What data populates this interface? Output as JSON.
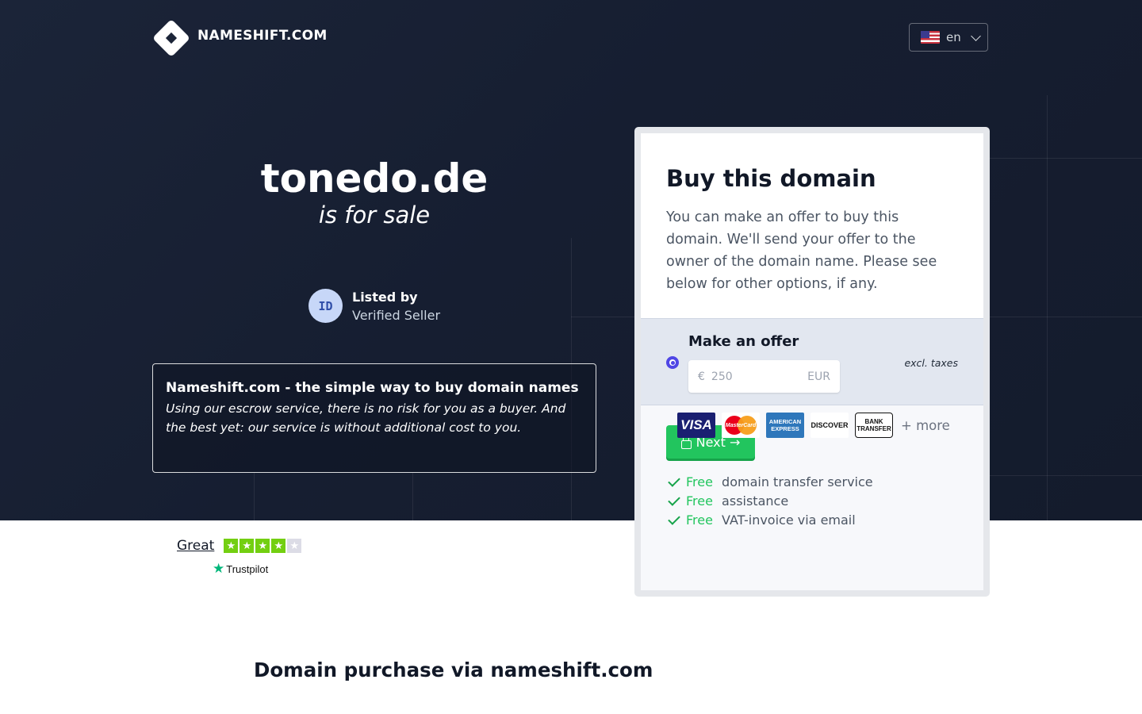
{
  "header": {
    "brand": "NAMESHIFT.COM",
    "language": "en"
  },
  "hero": {
    "domain": "tonedo.de",
    "tagline": "is for sale",
    "seller": {
      "initials": "ID",
      "label": "Listed by",
      "status": "Verified Seller"
    },
    "info": {
      "title": "Nameshift.com - the simple way to buy domain names",
      "text": "Using our escrow service, there is no risk for you as a buyer. And the best yet: our service is without additional cost to you."
    }
  },
  "card": {
    "title": "Buy this domain",
    "description": "You can make an offer to buy this domain. We'll send your offer to the owner of the domain name. Please see below for other options, if any.",
    "offer": {
      "label": "Make an offer",
      "currency_symbol": "€",
      "placeholder": "250",
      "currency_code": "EUR",
      "tax_note": "excl. taxes",
      "selected": true
    },
    "next_label": "Next →",
    "perks": [
      {
        "free": "Free",
        "text": "domain transfer service"
      },
      {
        "free": "Free",
        "text": "assistance"
      },
      {
        "free": "Free",
        "text": "VAT-invoice via email"
      }
    ],
    "payment_methods": [
      "VISA",
      "MasterCard",
      "AMERICAN EXPRESS",
      "DISCOVER",
      "BANK TRANSFER"
    ],
    "more_label": "+ more"
  },
  "rating": {
    "word": "Great",
    "stars": 4,
    "provider": "Trustpilot"
  },
  "section": {
    "title": "Domain purchase via nameshift.com"
  },
  "colors": {
    "hero_bg": "#1b2438",
    "accent_green": "#22c55e",
    "radio": "#4f46e5",
    "trustpilot": "#00b67a"
  }
}
